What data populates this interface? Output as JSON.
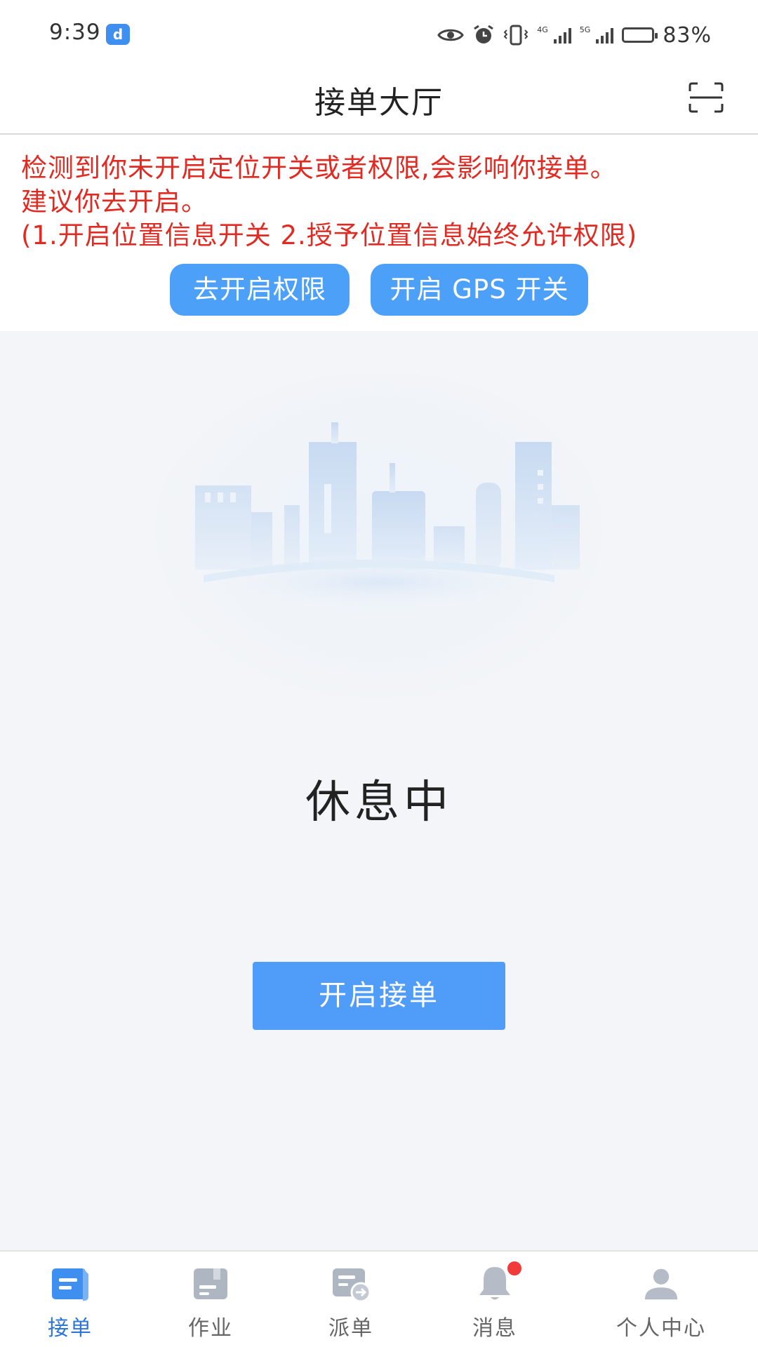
{
  "status_bar": {
    "time": "9:39",
    "battery": "83%",
    "battery_level": 0.83,
    "net_4g": "4G",
    "net_5g": "5G"
  },
  "header": {
    "title": "接单大厅",
    "scan_icon": "scan-icon"
  },
  "warning": {
    "line1": "检测到你未开启定位开关或者权限,会影响你接单。",
    "line2": "建议你去开启。",
    "line3": "(1.开启位置信息开关 2.授予位置信息始终允许权限)",
    "permission_button": "去开启权限",
    "gps_button": "开启 GPS 开关",
    "color": "#e02a22"
  },
  "main": {
    "status_text": "休息中",
    "start_button": "开启接单"
  },
  "bottom_nav": {
    "items": [
      {
        "label": "接单",
        "icon": "order-icon",
        "active": true
      },
      {
        "label": "作业",
        "icon": "task-icon",
        "active": false
      },
      {
        "label": "派单",
        "icon": "dispatch-icon",
        "active": false
      },
      {
        "label": "消息",
        "icon": "bell-icon",
        "active": false,
        "badge": true
      },
      {
        "label": "个人中心",
        "icon": "person-icon",
        "active": false
      }
    ]
  },
  "colors": {
    "accent": "#4f9cf9",
    "active_nav": "#2e76d6",
    "badge": "#f23a3a"
  }
}
